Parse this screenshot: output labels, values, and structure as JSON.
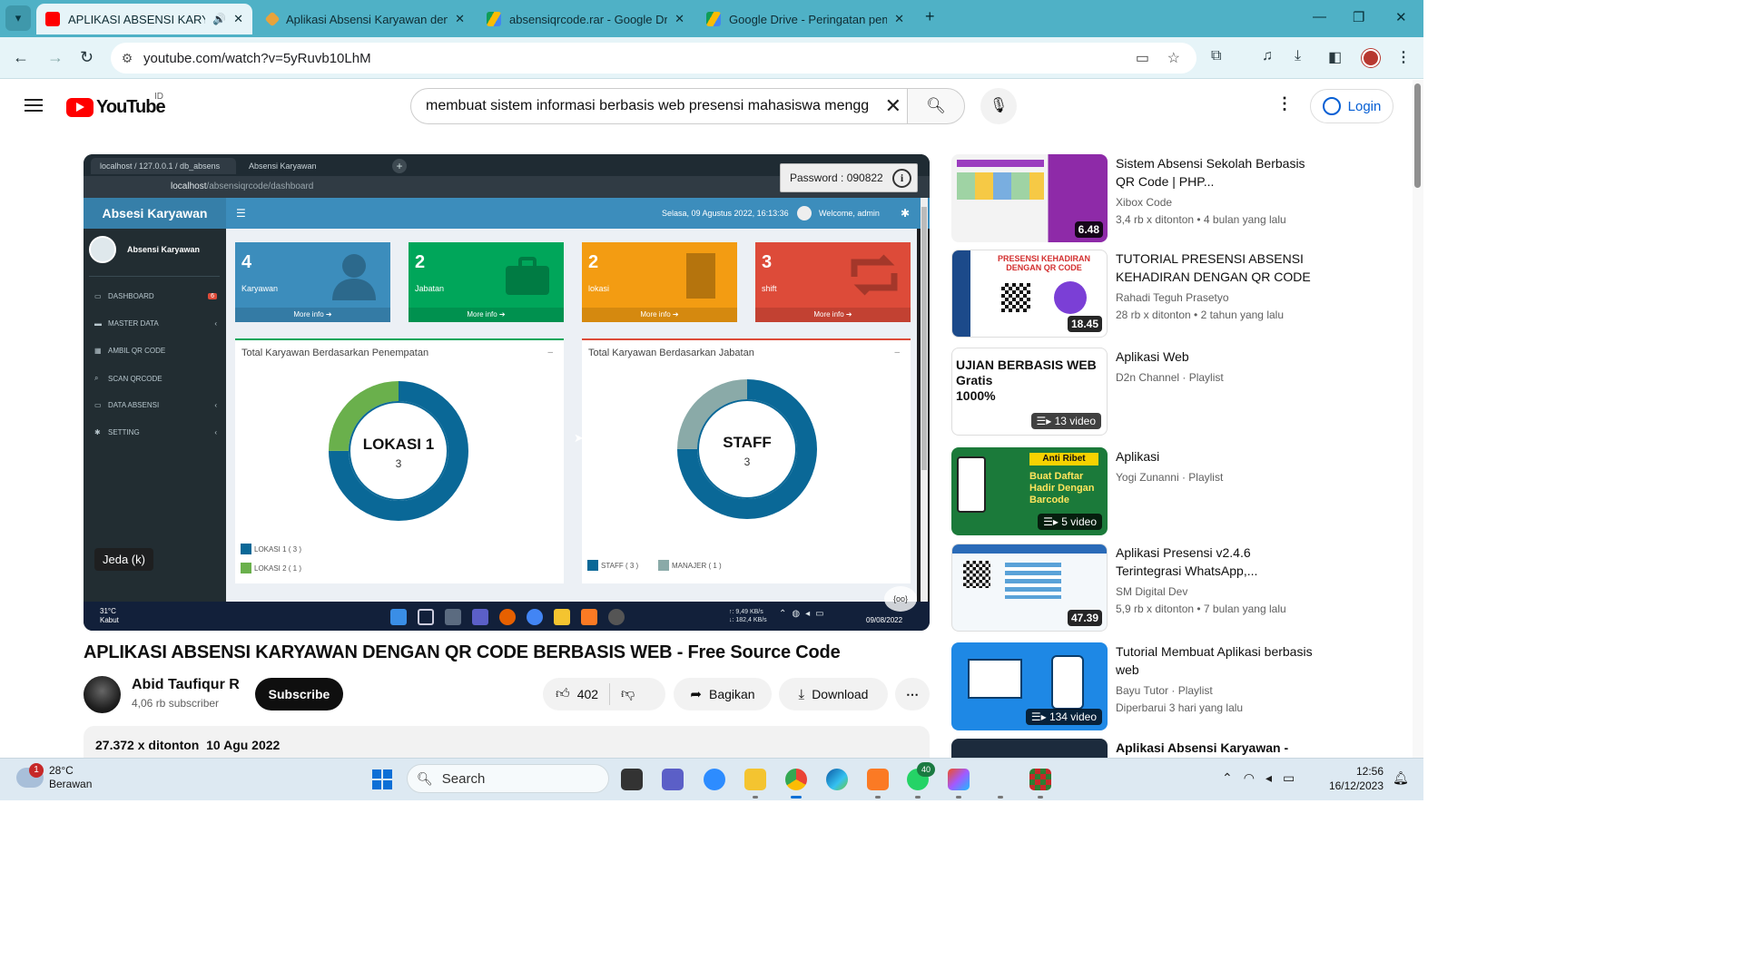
{
  "browser": {
    "tabs": [
      {
        "title": "APLIKASI ABSENSI KARYAW",
        "active": true,
        "audio": true
      },
      {
        "title": "Aplikasi Absensi Karyawan den"
      },
      {
        "title": "absensiqrcode.rar - Google Driv"
      },
      {
        "title": "Google Drive - Peringatan pem"
      }
    ],
    "url": "youtube.com/watch?v=5yRuvb10LhM"
  },
  "youtube": {
    "logo_text": "YouTube",
    "country_code": "ID",
    "search_value": "membuat sistem informasi berbasis web presensi mahasiswa mengg",
    "login_label": "Login"
  },
  "player": {
    "inner_tabs": [
      "localhost / 127.0.0.1 / db_absens",
      "Absensi Karyawan"
    ],
    "inner_url_host": "localhost",
    "inner_url_path": "/absensiqrcode/dashboard",
    "password_popup": "Password : 090822",
    "app_brand": "Absesi Karyawan",
    "app_date": "Selasa, 09 Agustus 2022, 16:13:36",
    "app_welcome": "Welcome, admin",
    "side_user": "Absensi Karyawan",
    "sidebar": [
      {
        "label": "DASHBOARD",
        "badge": "6"
      },
      {
        "label": "MASTER DATA",
        "chev": true
      },
      {
        "label": "AMBIL QR CODE"
      },
      {
        "label": "SCAN QRCODE"
      },
      {
        "label": "DATA ABSENSI",
        "chev": true
      },
      {
        "label": "SETTING",
        "chev": true
      }
    ],
    "stat_boxes": [
      {
        "num": "4",
        "label": "Karyawan",
        "color": "#3c8dbc"
      },
      {
        "num": "2",
        "label": "Jabatan",
        "color": "#00a65a"
      },
      {
        "num": "2",
        "label": "lokasi",
        "color": "#f39c12"
      },
      {
        "num": "3",
        "label": "shift",
        "color": "#dd4b39"
      }
    ],
    "more_info": "More info",
    "panels": [
      {
        "title": "Total Karyawan Berdasarkan Penempatan",
        "center_label": "LOKASI 1",
        "center_value": "3",
        "legend": [
          "LOKASI 1 ( 3 )",
          "LOKASI 2 ( 1 )"
        ]
      },
      {
        "title": "Total Karyawan Berdasarkan Jabatan",
        "center_label": "STAFF",
        "center_value": "3",
        "legend": [
          "STAFF ( 3 )",
          "MANAJER ( 1 )"
        ]
      }
    ],
    "taskbar_weather": "31°C",
    "taskbar_weather_sub": "Kabut",
    "net_up": "↑: 9,49 KB/s",
    "net_down": "↓: 182,4 KB/s",
    "taskbar_date": "09/08/2022",
    "pause_tooltip": "Jeda (k)"
  },
  "video": {
    "title": "APLIKASI ABSENSI KARYAWAN DENGAN QR CODE BERBASIS WEB - Free Source Code",
    "channel": "Abid Taufiqur R",
    "subscribers": "4,06 rb subscriber",
    "subscribe_label": "Subscribe",
    "likes": "402",
    "share_label": "Bagikan",
    "download_label": "Download",
    "views_date": "27.372 x ditonton  10 Agu 2022"
  },
  "recommendations": [
    {
      "title": "Sistem Absensi Sekolah Berbasis QR Code | PHP...",
      "channel": "Xibox Code",
      "meta": "3,4 rb x ditonton  • 4 bulan yang lalu",
      "badge": "6.48"
    },
    {
      "title": "TUTORIAL PRESENSI ABSENSI KEHADIRAN DENGAN QR CODE",
      "channel": "Rahadi Teguh Prasetyo",
      "meta": "28 rb x ditonton  • 2 tahun yang lalu",
      "badge": "18.45"
    },
    {
      "title": "Aplikasi Web",
      "channel": "D2n Channel · Playlist",
      "meta": "",
      "badge": "13 video"
    },
    {
      "title": "Aplikasi",
      "channel": "Yogi Zunanni · Playlist",
      "meta": "",
      "badge": "5 video"
    },
    {
      "title": "Aplikasi Presensi v2.4.6 Terintegrasi WhatsApp,...",
      "channel": "SM Digital Dev",
      "meta": "5,9 rb x ditonton  • 7 bulan yang lalu",
      "badge": "47.39"
    },
    {
      "title": "Tutorial Membuat Aplikasi berbasis web",
      "channel": "Bayu Tutor · Playlist",
      "meta": "Diperbarui 3 hari yang lalu",
      "badge": "134 video"
    },
    {
      "title": "Aplikasi Absensi Karyawan -",
      "channel": "",
      "meta": "",
      "badge": ""
    }
  ],
  "taskbar": {
    "weather_temp": "28°C",
    "weather_desc": "Berawan",
    "weather_badge": "1",
    "search_placeholder": "Search",
    "whatsapp_badge": "40",
    "time": "12:56",
    "date": "16/12/2023"
  },
  "colors": {
    "chrome_frame": "#4fb1c6",
    "yt_red": "#ff0000",
    "link_blue": "#065fd4"
  }
}
